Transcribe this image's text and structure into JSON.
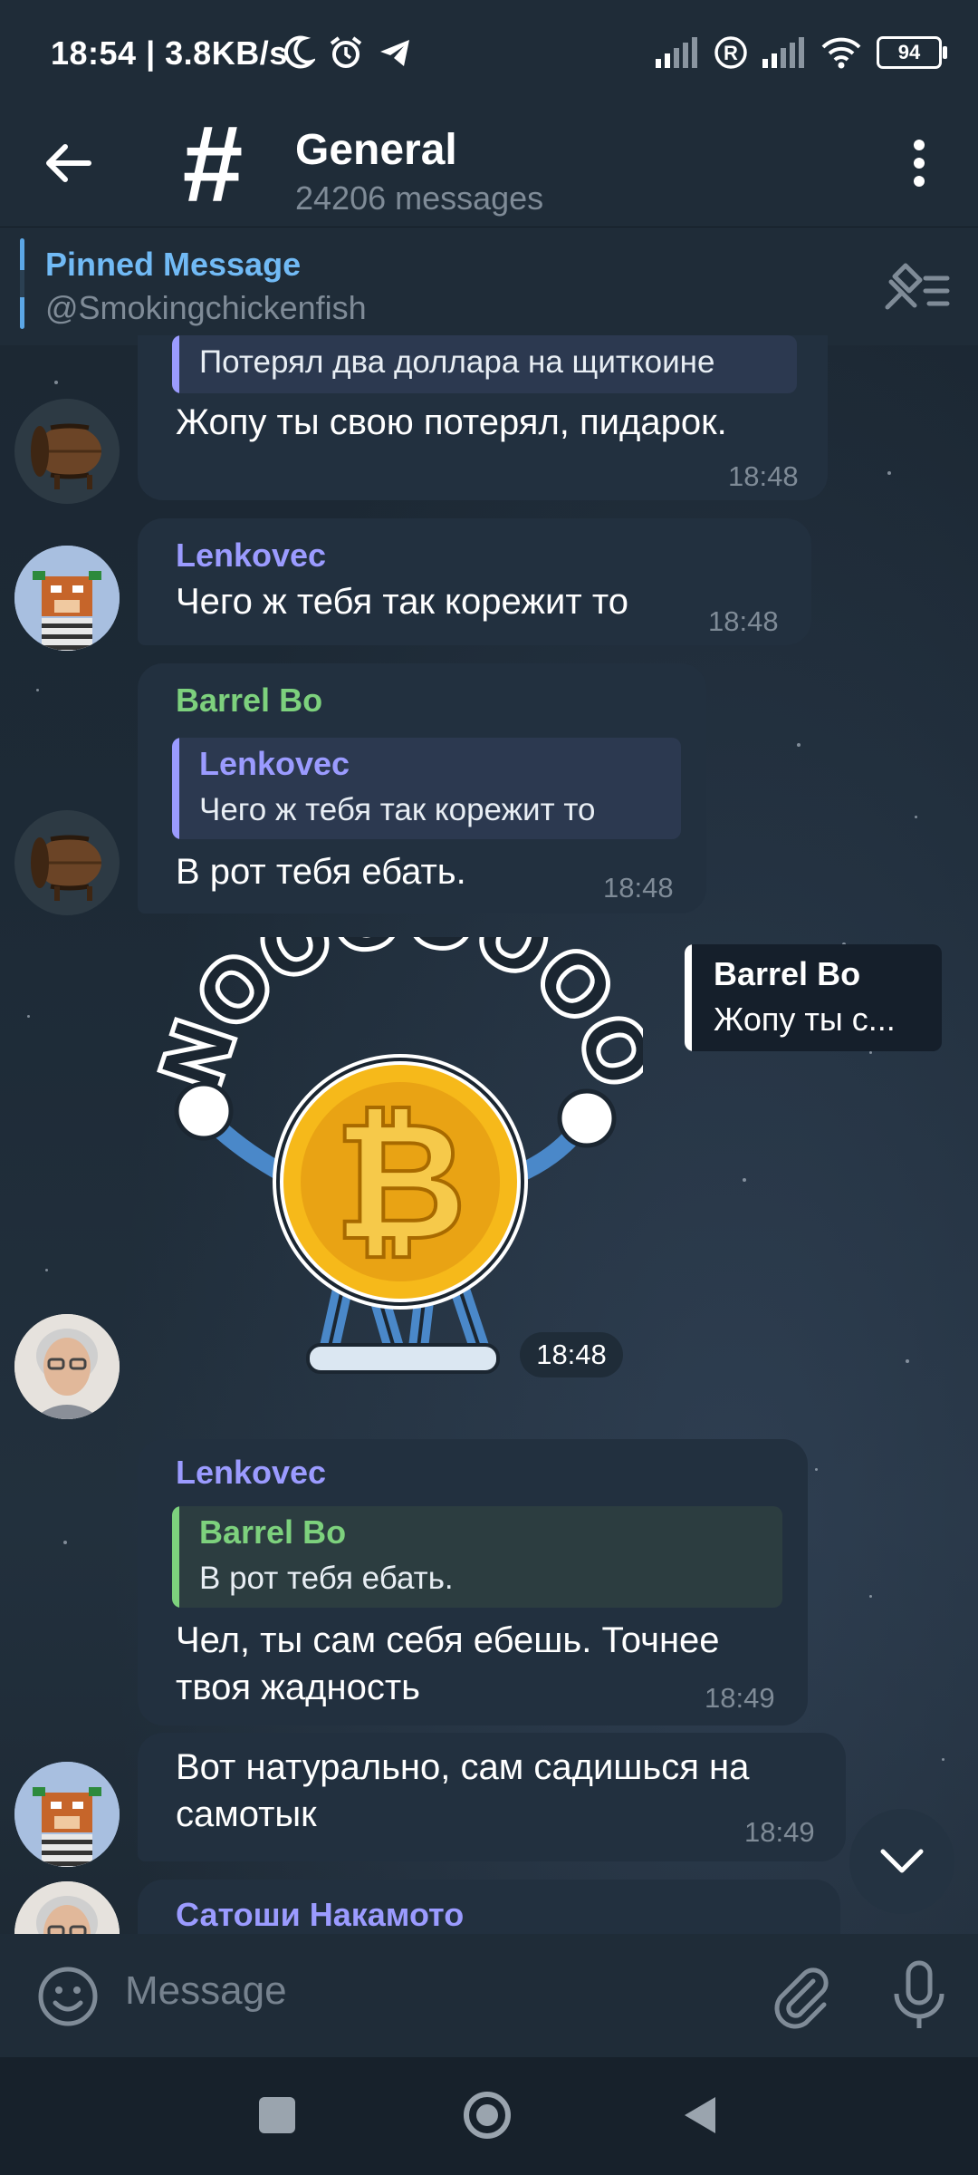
{
  "status_bar": {
    "time_speed": "18:54 | 3.8KB/s",
    "battery": "94"
  },
  "header": {
    "title": "General",
    "subtitle": "24206 messages"
  },
  "pinned": {
    "title": "Pinned Message",
    "text": "@Smokingchickenfish"
  },
  "messages": [
    {
      "reply_text": "Потерял два доллара на щиткоине",
      "text": "Жопу ты свою потерял, пидарок.",
      "time": "18:48"
    },
    {
      "sender": "Lenkovec",
      "text": "Чего ж тебя так корежит то",
      "time": "18:48"
    },
    {
      "sender": "Barrel Bo",
      "reply_name": "Lenkovec",
      "reply_text": "Чего ж тебя так корежит то",
      "text": "В рот тебя ебать.",
      "time": "18:48"
    },
    {
      "sticker_text": "NOOOOOOO",
      "reply_name": "Barrel Bo",
      "reply_text": "Жопу ты с...",
      "time": "18:48"
    },
    {
      "sender": "Lenkovec",
      "reply_name": "Barrel Bo",
      "reply_text": "В рот тебя ебать.",
      "text_line1": "Чел, ты сам себя ебешь. Точнее",
      "text_line2": "твоя жадность",
      "time": "18:49"
    },
    {
      "text_line1": "Вот натурально, сам садишься на",
      "text_line2": "самотык",
      "time": "18:49"
    },
    {
      "sender": "Сатоши Накамото"
    }
  ],
  "composer": {
    "placeholder": "Message"
  },
  "colors": {
    "accent_blue": "#71baf5",
    "name_purple": "#9b9bff",
    "name_green": "#7dd17d"
  }
}
